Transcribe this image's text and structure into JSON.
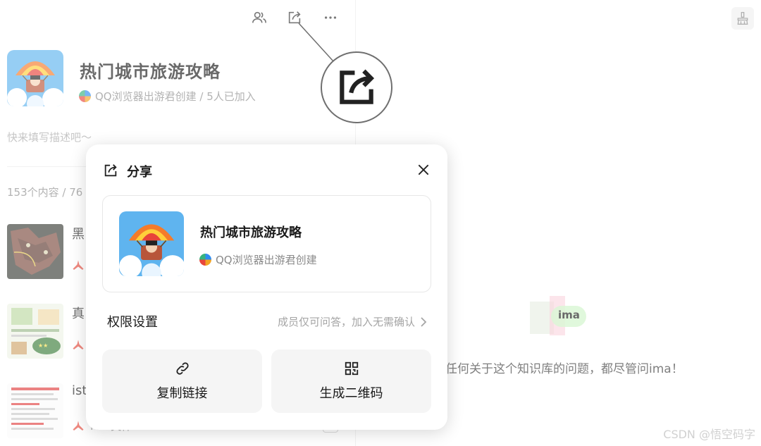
{
  "knowledge_base": {
    "title": "热门城市旅游攻略",
    "creator_line": "QQ浏览器出游君创建 / 5人已加入",
    "description_placeholder": "快来填写描述吧～",
    "content_count": "153个内容 / 76"
  },
  "toolbar": {
    "icons": [
      "members-icon",
      "share-icon",
      "more-icon"
    ]
  },
  "list": {
    "items": [
      {
        "title": "黑",
        "type": ""
      },
      {
        "title": "真",
        "type": ""
      },
      {
        "title": "ist",
        "type": "PDF文件"
      }
    ]
  },
  "share_dialog": {
    "title": "分享",
    "card_title": "热门城市旅游攻略",
    "card_creator": "QQ浏览器出游君创建",
    "permission_label": "权限设置",
    "permission_value": "成员仅可问答，加入无需确认",
    "copy_link_label": "复制链接",
    "qrcode_label": "生成二维码"
  },
  "assistant": {
    "logo_text": "ima",
    "prompt": "任何关于这个知识库的问题，都尽管问ima！"
  },
  "watermark": "CSDN @悟空码字",
  "colors": {
    "pdf_red": "#e64b3c",
    "muted_text": "#8a8a8a",
    "button_bg": "#f5f5f5"
  }
}
